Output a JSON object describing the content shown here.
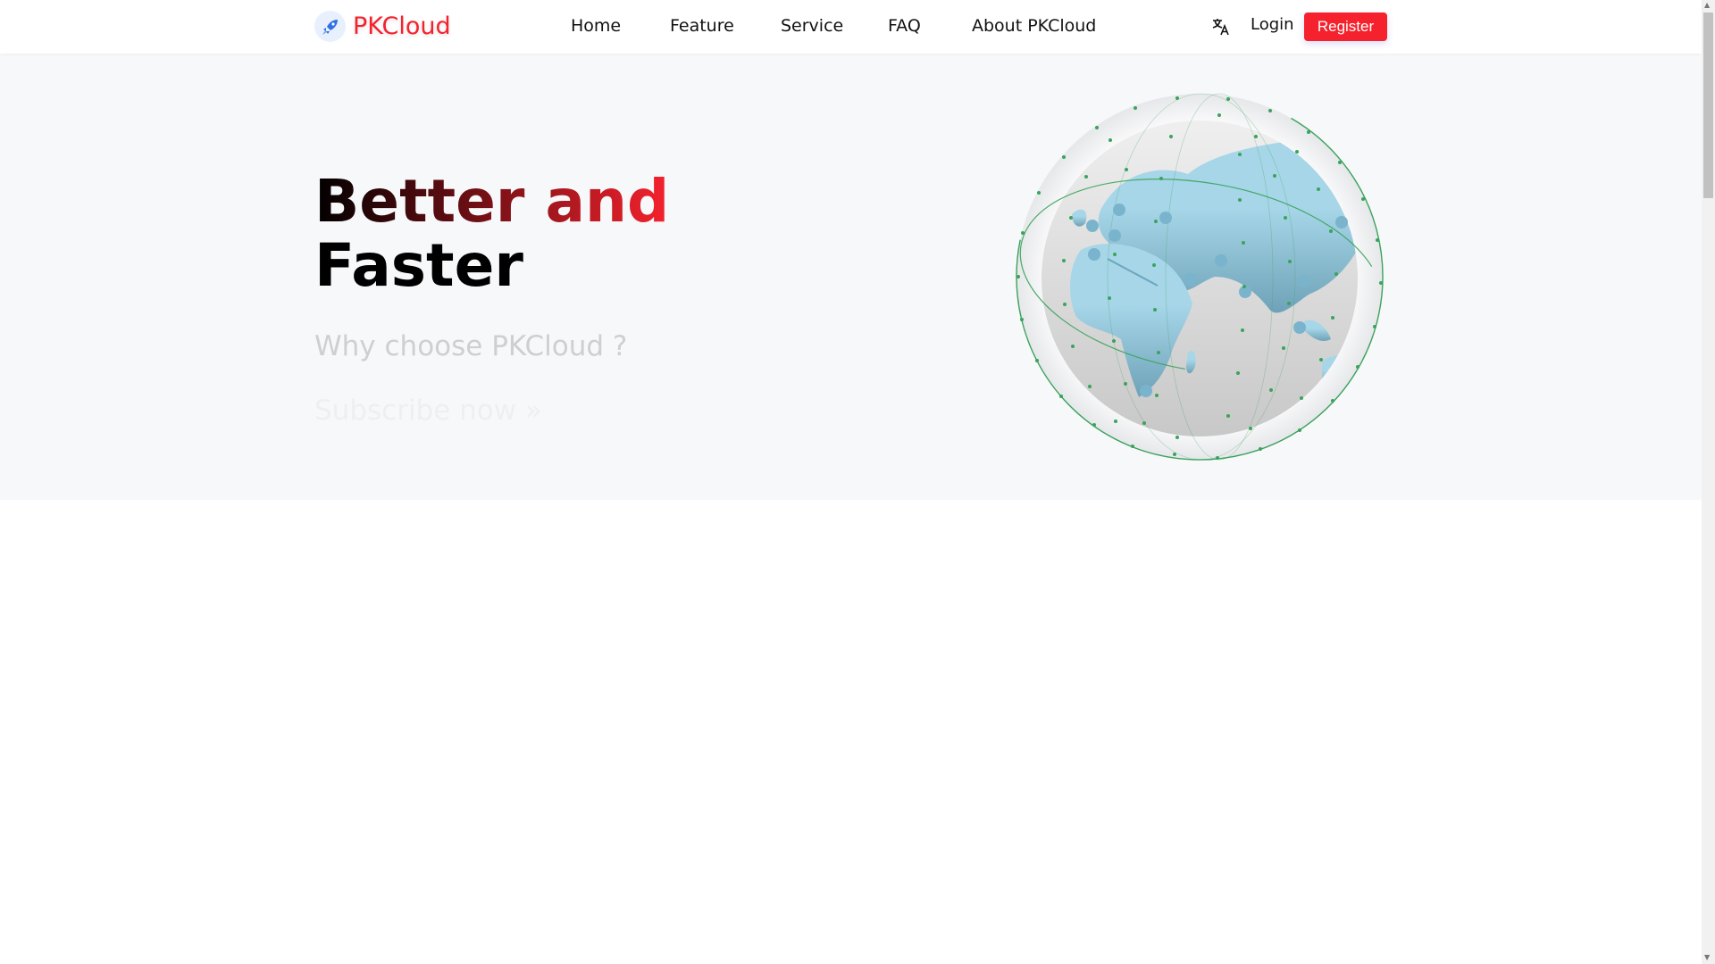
{
  "header": {
    "brand": "PKCloud",
    "nav": [
      "Home",
      "Feature",
      "Service",
      "FAQ",
      "About PKCloud"
    ],
    "login": "Login",
    "register": "Register",
    "lang_icon": "translate-icon"
  },
  "hero": {
    "title_line1": "Better and",
    "title_line2": "Faster",
    "subtitle": "Why choose PKCloud ?",
    "cta": "Subscribe now »"
  },
  "colors": {
    "brand": "#f5222d",
    "hero_bg": "#f7f8fa",
    "land": "#a6d6e8",
    "orbit": "#3aa35c"
  }
}
